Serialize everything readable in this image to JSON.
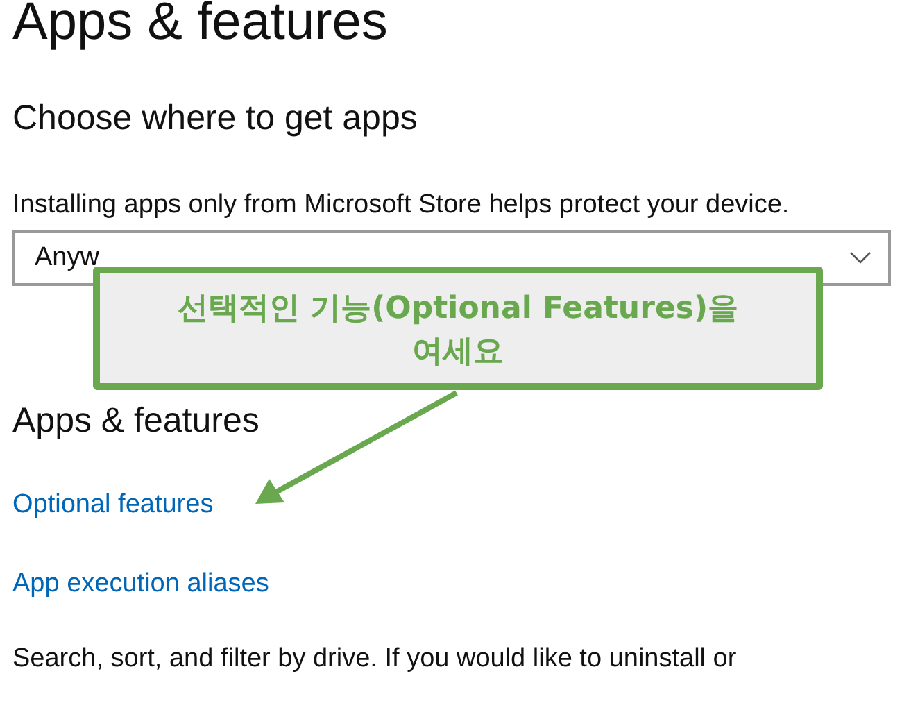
{
  "page_title": "Apps & features",
  "section": {
    "heading": "Choose where to get apps",
    "description": "Installing apps only from Microsoft Store helps protect your device.",
    "dropdown": {
      "value": "Anyw"
    }
  },
  "callout": {
    "text": "선택적인 기능(Optional Features)을 여세요"
  },
  "apps_section": {
    "heading": "Apps & features",
    "links": [
      "Optional features",
      "App execution aliases"
    ],
    "description": "Search, sort, and filter by drive. If you would like to uninstall or"
  }
}
